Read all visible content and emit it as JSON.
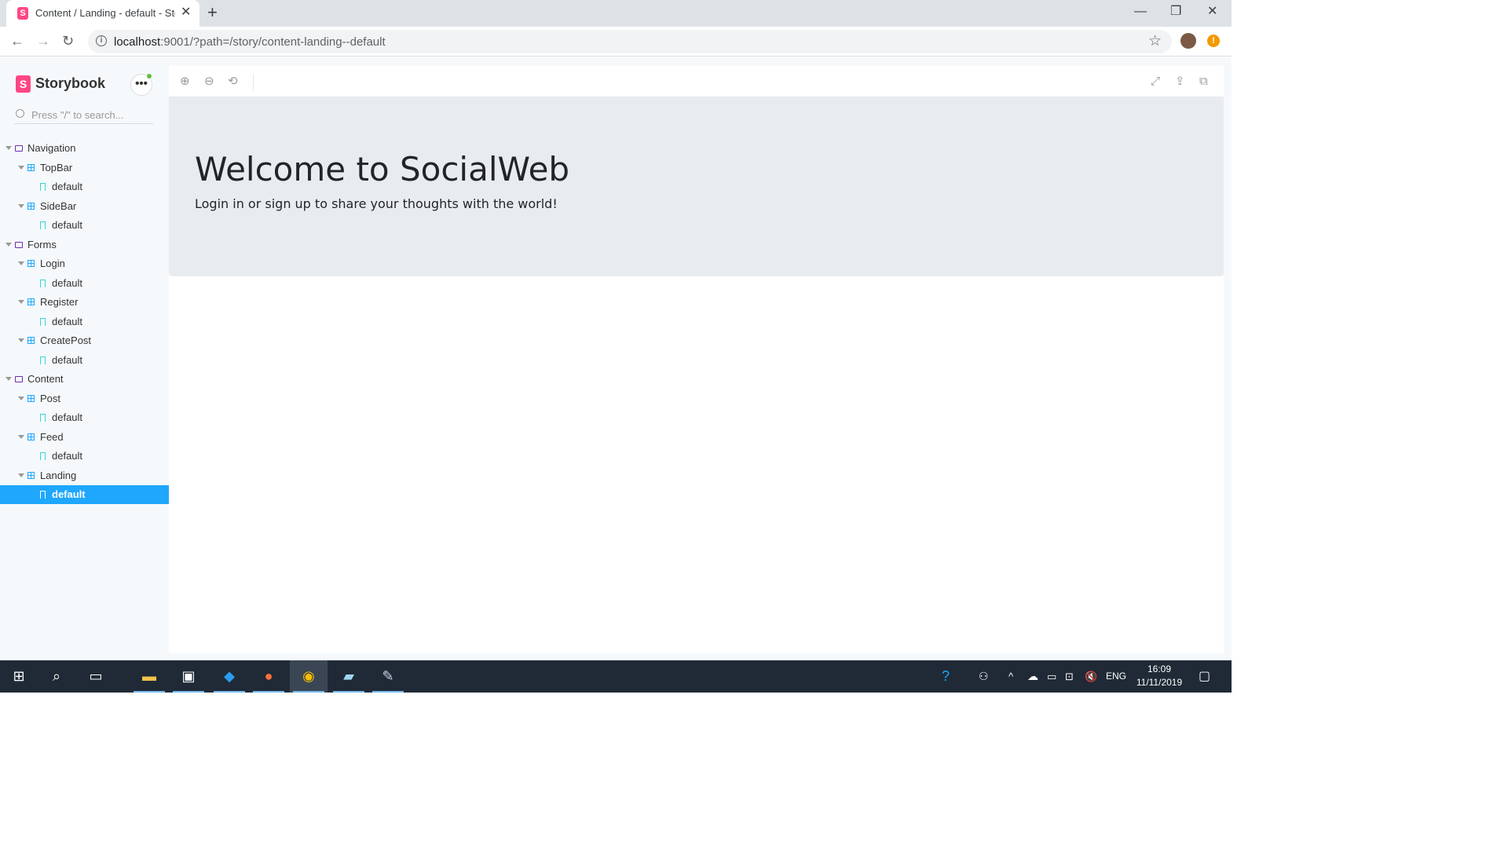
{
  "browser": {
    "tab_title": "Content / Landing - default - Storybook",
    "new_tab": "+",
    "url_host": "localhost",
    "url_rest": ":9001/?path=/story/content-landing--default"
  },
  "storybook": {
    "brand": "Storybook",
    "search_placeholder": "Press \"/\" to search...",
    "tree": [
      {
        "label": "Navigation",
        "kind": "folder"
      },
      {
        "label": "TopBar",
        "kind": "component"
      },
      {
        "label": "default",
        "kind": "story"
      },
      {
        "label": "SideBar",
        "kind": "component"
      },
      {
        "label": "default",
        "kind": "story"
      },
      {
        "label": "Forms",
        "kind": "folder"
      },
      {
        "label": "Login",
        "kind": "component"
      },
      {
        "label": "default",
        "kind": "story"
      },
      {
        "label": "Register",
        "kind": "component"
      },
      {
        "label": "default",
        "kind": "story"
      },
      {
        "label": "CreatePost",
        "kind": "component"
      },
      {
        "label": "default",
        "kind": "story"
      },
      {
        "label": "Content",
        "kind": "folder"
      },
      {
        "label": "Post",
        "kind": "component"
      },
      {
        "label": "default",
        "kind": "story"
      },
      {
        "label": "Feed",
        "kind": "component"
      },
      {
        "label": "default",
        "kind": "story"
      },
      {
        "label": "Landing",
        "kind": "component"
      },
      {
        "label": "default",
        "kind": "story",
        "selected": true
      }
    ]
  },
  "preview": {
    "title": "Welcome to SocialWeb",
    "lead": "Login in or sign up to share your thoughts with the world!"
  },
  "taskbar": {
    "lang": "ENG",
    "time": "16:09",
    "date": "11/11/2019"
  },
  "colors": {
    "storybook_pink": "#ff4785",
    "selection_blue": "#1ea7fd",
    "jumbotron_bg": "#e9ecef"
  }
}
